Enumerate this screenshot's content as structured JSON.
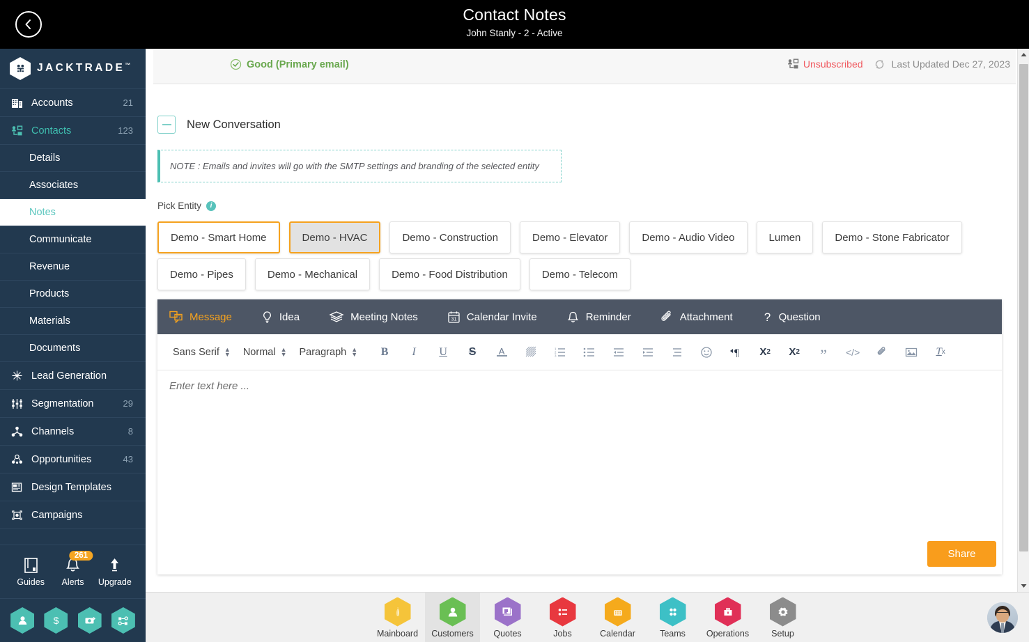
{
  "topbar": {
    "title": "Contact Notes",
    "subtitle": "John Stanly - 2 - Active",
    "back_label": "Back"
  },
  "sidebar": {
    "brand": "JACKTRADE",
    "brand_tm": "™",
    "items": [
      {
        "label": "Accounts",
        "count": "21",
        "icon": "building-icon"
      },
      {
        "label": "Contacts",
        "count": "123",
        "icon": "contacts-icon"
      }
    ],
    "sub_items": [
      {
        "label": "Details"
      },
      {
        "label": "Associates"
      },
      {
        "label": "Notes"
      },
      {
        "label": "Communicate"
      },
      {
        "label": "Revenue"
      },
      {
        "label": "Products"
      },
      {
        "label": "Materials"
      },
      {
        "label": "Documents"
      }
    ],
    "items2": [
      {
        "label": "Lead Generation",
        "count": "",
        "icon": "lead-gen-icon"
      },
      {
        "label": "Segmentation",
        "count": "29",
        "icon": "segmentation-icon"
      },
      {
        "label": "Channels",
        "count": "8",
        "icon": "channels-icon"
      },
      {
        "label": "Opportunities",
        "count": "43",
        "icon": "opportunities-icon"
      },
      {
        "label": "Design Templates",
        "count": "",
        "icon": "design-templates-icon"
      },
      {
        "label": "Campaigns",
        "count": "",
        "icon": "campaigns-icon"
      }
    ],
    "tools": [
      {
        "label": "Guides",
        "icon": "book-icon",
        "badge": ""
      },
      {
        "label": "Alerts",
        "icon": "bell-icon",
        "badge": "261"
      },
      {
        "label": "Upgrade",
        "icon": "up-arrow-icon",
        "badge": ""
      }
    ],
    "quick_actions": [
      {
        "icon": "person-hex-icon"
      },
      {
        "icon": "dollar-hex-icon"
      },
      {
        "icon": "money-transfer-hex-icon"
      },
      {
        "icon": "workflow-hex-icon"
      }
    ],
    "accent": "#4cbfb2",
    "bg": "#22394f"
  },
  "status": {
    "good_text": "Good (Primary email)",
    "unsubscribed": "Unsubscribed",
    "last_updated": "Last Updated Dec 27, 2023",
    "good_color": "#6aa84f",
    "unsub_color": "#f0585e"
  },
  "conversation": {
    "title": "New Conversation",
    "note": "NOTE : Emails and invites will go with the SMTP settings and branding of the selected entity"
  },
  "entities": {
    "label": "Pick Entity",
    "info": "i",
    "row1": [
      {
        "label": "Demo - Smart Home",
        "state": "selected"
      },
      {
        "label": "Demo - HVAC",
        "state": "hover"
      },
      {
        "label": "Demo - Construction",
        "state": "default"
      },
      {
        "label": "Demo - Elevator",
        "state": "default"
      },
      {
        "label": "Demo - Audio Video",
        "state": "default"
      },
      {
        "label": "Lumen",
        "state": "default"
      },
      {
        "label": "Demo - Stone Fabricator",
        "state": "default"
      }
    ],
    "row2": [
      {
        "label": "Demo - Pipes",
        "state": "default"
      },
      {
        "label": "Demo - Mechanical",
        "state": "default"
      },
      {
        "label": "Demo - Food Distribution",
        "state": "default"
      },
      {
        "label": "Demo - Telecom",
        "state": "default"
      }
    ],
    "selected_color": "#f5a21e"
  },
  "editor": {
    "types": [
      {
        "label": "Message",
        "icon": "message-icon",
        "active": true
      },
      {
        "label": "Idea",
        "icon": "lightbulb-icon",
        "active": false
      },
      {
        "label": "Meeting Notes",
        "icon": "layers-icon",
        "active": false
      },
      {
        "label": "Calendar Invite",
        "icon": "calendar-31-icon",
        "active": false
      },
      {
        "label": "Reminder",
        "icon": "bell-icon",
        "active": false
      },
      {
        "label": "Attachment",
        "icon": "paperclip-icon",
        "active": false
      },
      {
        "label": "Question",
        "icon": "question-mark-icon",
        "active": false
      }
    ],
    "font_family": "Sans Serif",
    "font_size": "Normal",
    "block_style": "Paragraph",
    "tools": [
      {
        "name": "bold-icon",
        "glyph": "B"
      },
      {
        "name": "italic-icon",
        "glyph": "I"
      },
      {
        "name": "underline-icon",
        "glyph": "U"
      },
      {
        "name": "strikethrough-icon",
        "glyph": "S"
      },
      {
        "name": "text-color-icon",
        "glyph": "A"
      },
      {
        "name": "highlight-color-icon",
        "glyph": "A"
      },
      {
        "name": "ordered-list-icon",
        "glyph": ""
      },
      {
        "name": "bullet-list-icon",
        "glyph": ""
      },
      {
        "name": "outdent-icon",
        "glyph": ""
      },
      {
        "name": "indent-icon",
        "glyph": ""
      },
      {
        "name": "align-icon",
        "glyph": ""
      },
      {
        "name": "emoji-icon",
        "glyph": ""
      },
      {
        "name": "text-direction-icon",
        "glyph": "¶"
      },
      {
        "name": "subscript-icon",
        "glyph": "X"
      },
      {
        "name": "superscript-icon",
        "glyph": "X"
      },
      {
        "name": "blockquote-icon",
        "glyph": "”"
      },
      {
        "name": "code-icon",
        "glyph": "</>"
      },
      {
        "name": "link-icon",
        "glyph": ""
      },
      {
        "name": "image-icon",
        "glyph": ""
      },
      {
        "name": "clear-format-icon",
        "glyph": "T"
      }
    ],
    "placeholder": "Enter text here ...",
    "share_label": "Share",
    "share_color": "#f99d1c",
    "typebar_bg": "#4d5665"
  },
  "bottom_nav": [
    {
      "label": "Mainboard",
      "color": "#f5c43a",
      "icon": "feather-icon",
      "selected": false
    },
    {
      "label": "Customers",
      "color": "#6abf54",
      "icon": "person-icon",
      "selected": true
    },
    {
      "label": "Quotes",
      "color": "#9b72c9",
      "icon": "quote-card-icon",
      "selected": false
    },
    {
      "label": "Jobs",
      "color": "#e8383f",
      "icon": "list-icon",
      "selected": false
    },
    {
      "label": "Calendar",
      "color": "#f5aa1c",
      "icon": "calendar-icon",
      "selected": false
    },
    {
      "label": "Teams",
      "color": "#3dc0c6",
      "icon": "team-dots-icon",
      "selected": false
    },
    {
      "label": "Operations",
      "color": "#e03057",
      "icon": "briefcase-icon",
      "selected": false
    },
    {
      "label": "Setup",
      "color": "#8c8c8c",
      "icon": "gear-icon",
      "selected": false
    }
  ]
}
